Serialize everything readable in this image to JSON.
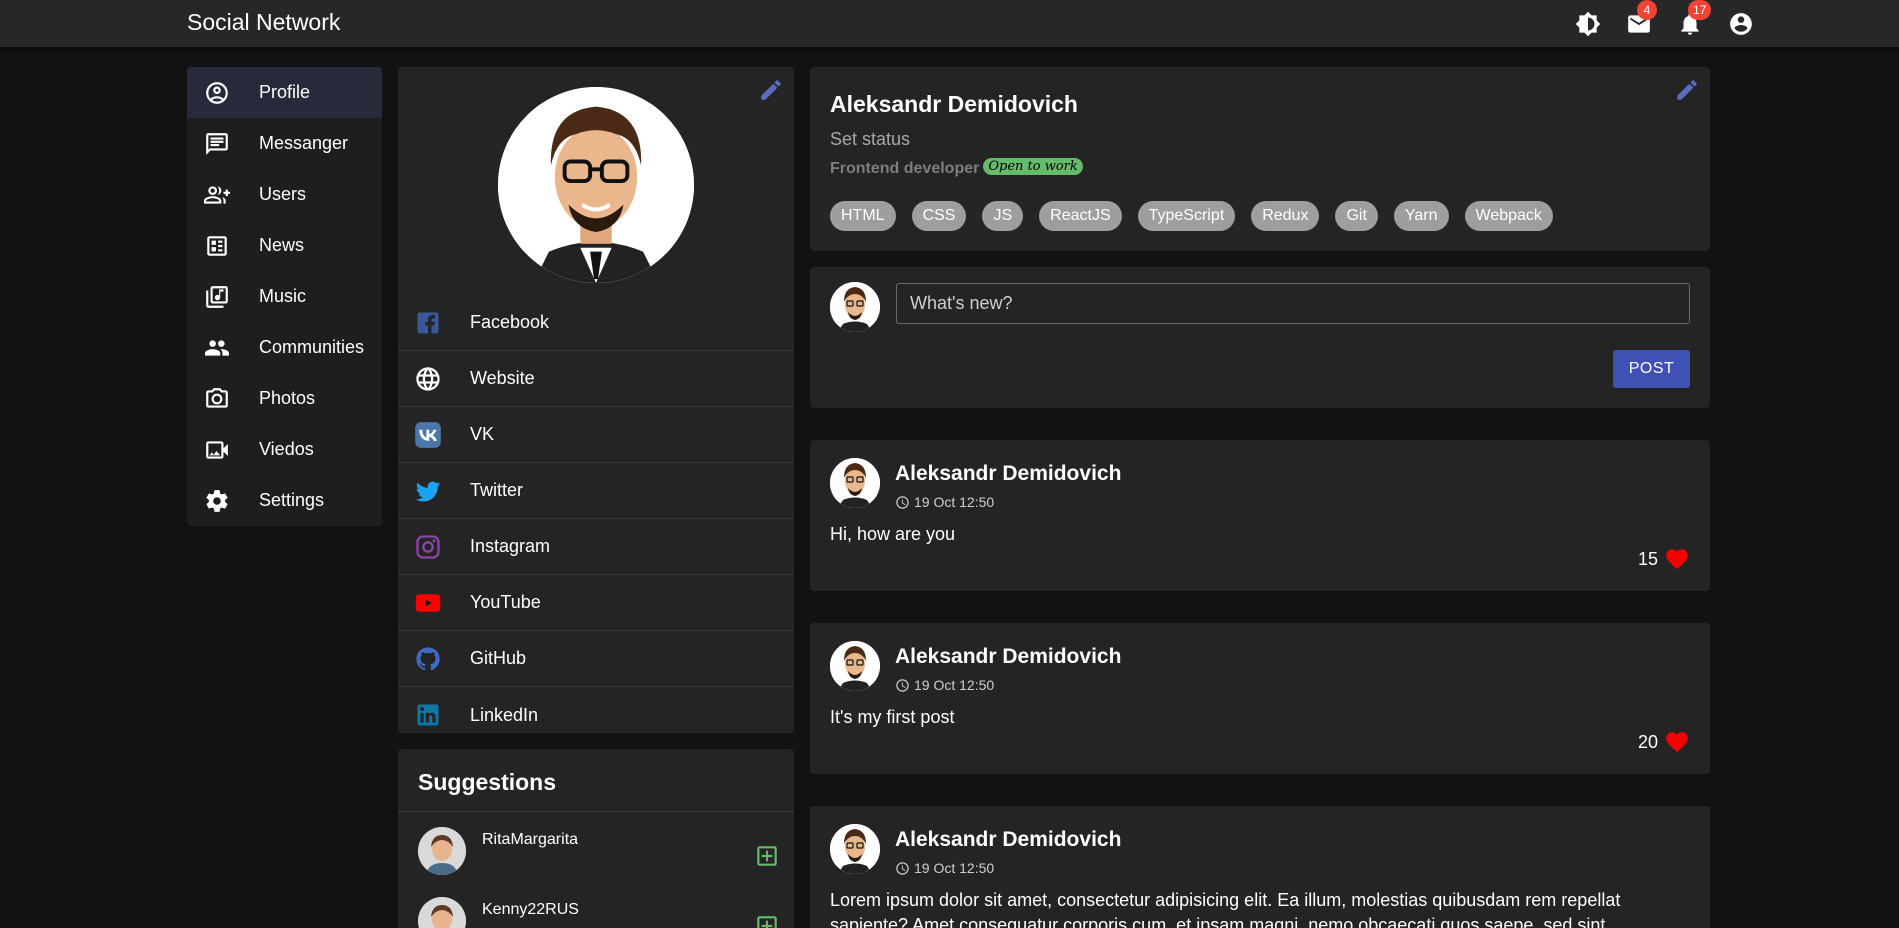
{
  "app": {
    "title": "Social Network"
  },
  "appbar": {
    "icons": [
      "brightness-icon",
      "mail-icon",
      "bell-icon",
      "account-icon"
    ],
    "mail_badge": "4",
    "notifications_badge": "17"
  },
  "nav": {
    "items": [
      {
        "label": "Profile",
        "icon": "account-circle-icon",
        "active": true
      },
      {
        "label": "Messanger",
        "icon": "message-icon"
      },
      {
        "label": "Users",
        "icon": "group-add-icon"
      },
      {
        "label": "News",
        "icon": "newspaper-icon"
      },
      {
        "label": "Music",
        "icon": "library-music-icon"
      },
      {
        "label": "Communities",
        "icon": "people-icon"
      },
      {
        "label": "Photos",
        "icon": "camera-icon"
      },
      {
        "label": "Viedos",
        "icon": "video-icon"
      },
      {
        "label": "Settings",
        "icon": "gear-icon"
      }
    ]
  },
  "social": {
    "items": [
      {
        "label": "Facebook",
        "icon": "facebook-icon",
        "color": "#3b5998"
      },
      {
        "label": "Website",
        "icon": "globe-icon",
        "color": "#ffffff"
      },
      {
        "label": "VK",
        "icon": "vk-icon",
        "color": "#4a76a8"
      },
      {
        "label": "Twitter",
        "icon": "twitter-icon",
        "color": "#1da1f2"
      },
      {
        "label": "Instagram",
        "icon": "instagram-icon",
        "color": "#8e44ad"
      },
      {
        "label": "YouTube",
        "icon": "youtube-icon",
        "color": "#ff0000"
      },
      {
        "label": "GitHub",
        "icon": "github-icon",
        "color": "#3f6bc4"
      },
      {
        "label": "LinkedIn",
        "icon": "linkedin-icon",
        "color": "#0e76a8"
      }
    ]
  },
  "suggestions": {
    "title": "Suggestions",
    "items": [
      {
        "name": "RitaMargarita"
      },
      {
        "name": "Kenny22RUS"
      }
    ]
  },
  "profile": {
    "name": "Aleksandr Demidovich",
    "status": "Set status",
    "job": "Frontend developer",
    "open_badge": "Open to work",
    "skills": [
      "HTML",
      "CSS",
      "JS",
      "ReactJS",
      "TypeScript",
      "Redux",
      "Git",
      "Yarn",
      "Webpack"
    ]
  },
  "new_post": {
    "placeholder": "What's new?",
    "button": "POST"
  },
  "posts": [
    {
      "author": "Aleksandr Demidovich",
      "time": "19 Oct 12:50",
      "text": "Hi, how are you",
      "likes": "15"
    },
    {
      "author": "Aleksandr Demidovich",
      "time": "19 Oct 12:50",
      "text": "It's my first post",
      "likes": "20"
    },
    {
      "author": "Aleksandr Demidovich",
      "time": "19 Oct 12:50",
      "text": "Lorem ipsum dolor sit amet, consectetur adipisicing elit. Ea illum, molestias quibusdam rem repellat sapiente? Amet consequatur corporis cum, et ipsam magni, nemo obcaecati quos saepe, sed sint",
      "likes": ""
    }
  ],
  "colors": {
    "accent": "#3f51b5",
    "like": "#f50000",
    "open_badge": "#66bb6a",
    "chip": "#9e9e9e"
  }
}
